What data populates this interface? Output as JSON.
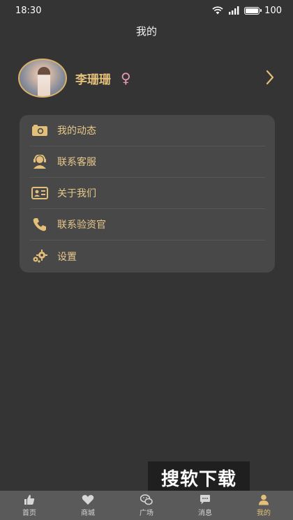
{
  "status_bar": {
    "time": "18:30",
    "battery": "100",
    "battery_level": 1.0
  },
  "header": {
    "title": "我的"
  },
  "profile": {
    "name": "李珊珊",
    "gender_symbol": "♀"
  },
  "menu": {
    "items": [
      {
        "label": "我的动态",
        "icon": "camera-icon"
      },
      {
        "label": "联系客服",
        "icon": "customer-service-icon"
      },
      {
        "label": "关于我们",
        "icon": "id-card-icon"
      },
      {
        "label": "联系验资官",
        "icon": "phone-icon"
      },
      {
        "label": "设置",
        "icon": "gear-icon"
      }
    ]
  },
  "watermark": {
    "text": "搜软下载"
  },
  "tabs": [
    {
      "label": "首页",
      "icon": "thumbs-up-icon",
      "active": false
    },
    {
      "label": "商城",
      "icon": "heart-icon",
      "active": false
    },
    {
      "label": "广场",
      "icon": "wechat-icon",
      "active": false
    },
    {
      "label": "消息",
      "icon": "chat-bubble-icon",
      "active": false
    },
    {
      "label": "我的",
      "icon": "person-icon",
      "active": true
    }
  ],
  "colors": {
    "accent": "#e3bf7a",
    "background": "#343434",
    "card": "#484848",
    "tab_bar": "#5a5a5a"
  }
}
